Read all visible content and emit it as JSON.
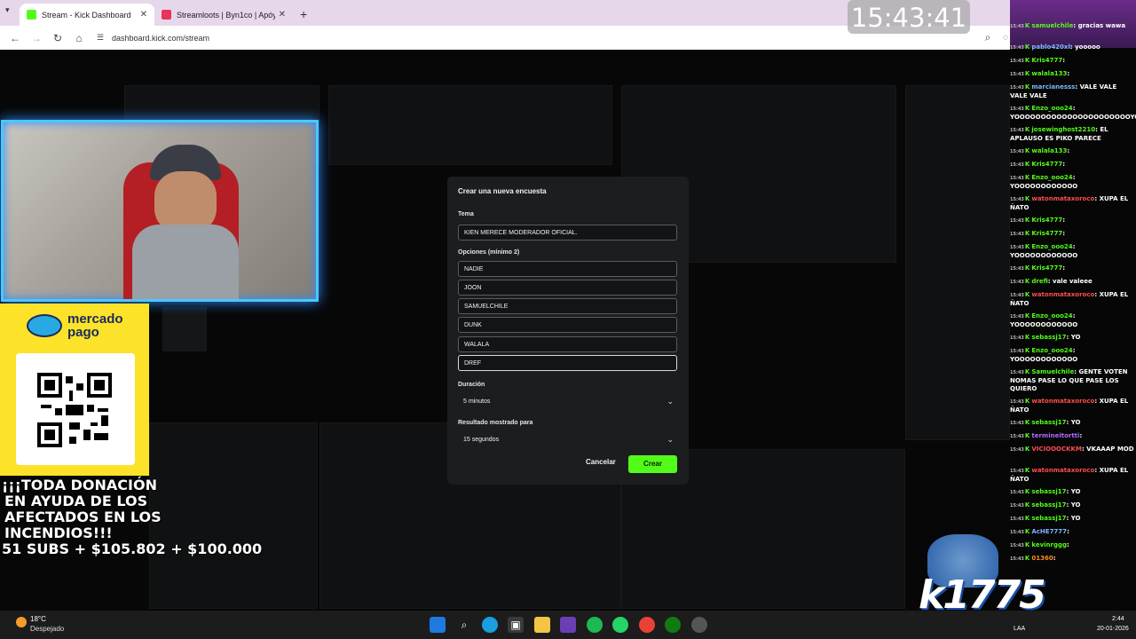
{
  "browser": {
    "tabs": [
      {
        "label": "Stream - Kick Dashboard",
        "favicon_color": "#53fc18",
        "active": true
      },
      {
        "label": "Streamloots | Byn1co | Apóyame",
        "favicon_color": "#e8345a",
        "active": false
      }
    ],
    "new_tab_symbol": "+",
    "url": "dashboard.kick.com/stream",
    "overlay_clock": "15:43:41"
  },
  "modal": {
    "title": "Crear una nueva encuesta",
    "topic_label": "Tema",
    "topic_value": "KIEN MERECE MODERADOR OFICIAL.",
    "options_label": "Opciones (mínimo 2)",
    "options": [
      "NADIE",
      "JOON",
      "SAMUELCHILE",
      "DUNK",
      "WALALA",
      "DREF"
    ],
    "duration_label": "Duración",
    "duration_value": "5 minutos",
    "result_label": "Resultado mostrado para",
    "result_value": "15 segundos",
    "cancel_label": "Cancelar",
    "create_label": "Crear",
    "accent_color": "#53fc18"
  },
  "overlay": {
    "mp_brand": "mercado pago",
    "donation_lines": [
      "¡¡¡TODA DONACIÓN",
      "EN AYUDA DE LOS",
      "AFECTADOS EN LOS",
      "INCENDIOS!!!",
      "51 SUBS + $105.802 + $100.000"
    ],
    "watermark": "k1775"
  },
  "chat": {
    "messages": [
      {
        "time": "15:43",
        "user": "samuelchile",
        "text": ": gracias wawa",
        "color": "#53fc18"
      },
      {
        "time": "15:43",
        "user": "pablo420xl",
        "text": ": yooooo",
        "color": "#7ab8ff"
      },
      {
        "time": "15:43",
        "user": "Kris4777",
        "text": ":",
        "color": "#53fc18"
      },
      {
        "time": "15:43",
        "user": "walala133",
        "text": ":",
        "color": "#53fc18"
      },
      {
        "time": "15:43",
        "user": "marcianesss",
        "text": ": VALE VALE VALE VALE",
        "color": "#7ab8ff"
      },
      {
        "time": "15:43",
        "user": "Enzo_ooo24",
        "text": ": YOOOOOOOOOOOOOOOOOOOOOOYOOO",
        "color": "#53fc18"
      },
      {
        "time": "15:43",
        "user": "josewinghost2210",
        "text": ": EL APLAUSO ES PIKO PARECE",
        "color": "#53fc18"
      },
      {
        "time": "15:43",
        "user": "walala133",
        "text": ":",
        "color": "#53fc18"
      },
      {
        "time": "15:43",
        "user": "Kris4777",
        "text": ":",
        "color": "#53fc18"
      },
      {
        "time": "15:43",
        "user": "Enzo_ooo24",
        "text": ": YOOOOOOOOOOOO",
        "color": "#53fc18"
      },
      {
        "time": "15:43",
        "user": "watonmataxoroco",
        "text": ": XUPA EL ÑATO",
        "color": "#ff4d4d"
      },
      {
        "time": "15:43",
        "user": "Kris4777",
        "text": ":",
        "color": "#53fc18"
      },
      {
        "time": "15:43",
        "user": "Kris4777",
        "text": ":",
        "color": "#53fc18"
      },
      {
        "time": "15:43",
        "user": "Enzo_ooo24",
        "text": ": YOOOOOOOOOOOO",
        "color": "#53fc18"
      },
      {
        "time": "15:43",
        "user": "Kris4777",
        "text": ":",
        "color": "#53fc18"
      },
      {
        "time": "15:43",
        "user": "drefi",
        "text": ": vale valeee",
        "color": "#53fc18"
      },
      {
        "time": "15:43",
        "user": "watonmataxoroco",
        "text": ": XUPA EL ÑATO",
        "color": "#ff4d4d"
      },
      {
        "time": "15:43",
        "user": "Enzo_ooo24",
        "text": ": YOOOOOOOOOOOO",
        "color": "#53fc18"
      },
      {
        "time": "15:43",
        "user": "sebassj17",
        "text": ": YO",
        "color": "#53fc18"
      },
      {
        "time": "15:43",
        "user": "Enzo_ooo24",
        "text": ": YOOOOOOOOOOOO",
        "color": "#53fc18"
      },
      {
        "time": "15:43",
        "user": "Samuelchile",
        "text": ": GENTE VOTEN NOMAS PASE LO QUE PASE LOS QUIERO",
        "color": "#53fc18"
      },
      {
        "time": "15:43",
        "user": "watonmataxoroco",
        "text": ": XUPA EL ÑATO",
        "color": "#ff4d4d"
      },
      {
        "time": "15:43",
        "user": "sebassj17",
        "text": ": YO",
        "color": "#53fc18"
      },
      {
        "time": "15:43",
        "user": "termineitortti",
        "text": ":",
        "color": "#b06bff"
      },
      {
        "time": "15:43",
        "user": "VICIOOOCKKM",
        "text": ": VKAAAP MOD",
        "color": "#ff4d4d"
      },
      {
        "time": "15:43",
        "user": "watonmataxoroco",
        "text": ": XUPA EL ÑATO",
        "color": "#ff4d4d"
      },
      {
        "time": "15:43",
        "user": "sebassj17",
        "text": ": YO",
        "color": "#53fc18"
      },
      {
        "time": "15:43",
        "user": "sebassj17",
        "text": ": YO",
        "color": "#53fc18"
      },
      {
        "time": "15:43",
        "user": "sebassj17",
        "text": ": YO",
        "color": "#53fc18"
      },
      {
        "time": "15:43",
        "user": "AcHE7777",
        "text": ":",
        "color": "#7ab8ff"
      },
      {
        "time": "15:43",
        "user": "kevinrggg",
        "text": ":",
        "color": "#53fc18"
      },
      {
        "time": "15:43",
        "user": "01360",
        "text": ":",
        "color": "#ff8c1a"
      }
    ]
  },
  "taskbar": {
    "temperature": "18°C",
    "weather": "Despejado",
    "language": "LAA",
    "time": "2:44",
    "date": "20-01-2026"
  }
}
